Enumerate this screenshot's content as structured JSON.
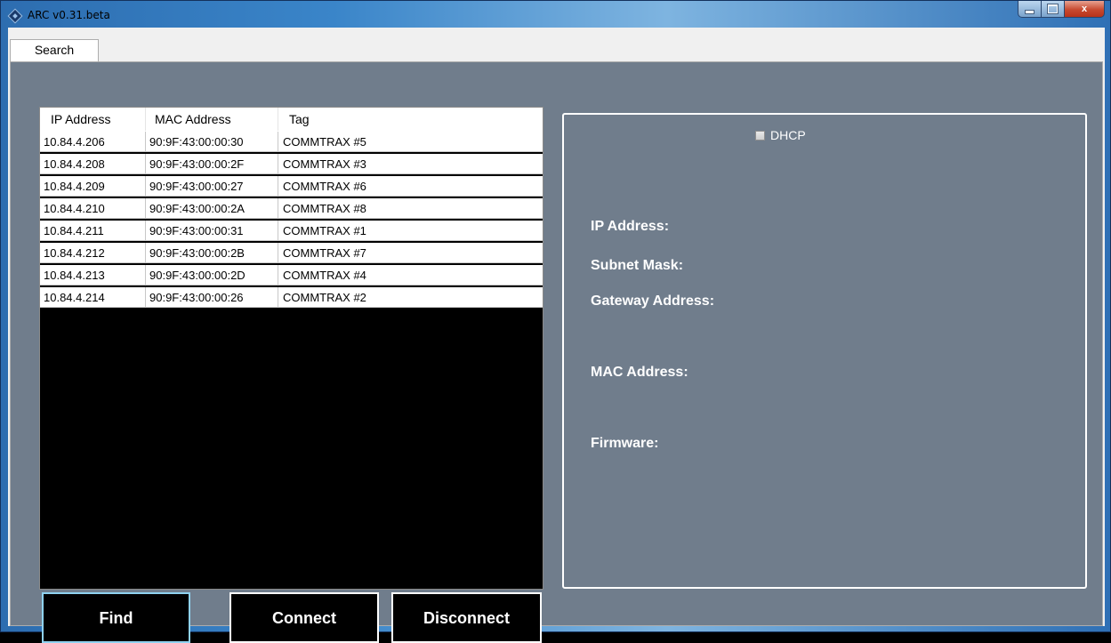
{
  "window": {
    "title": "ARC v0.31.beta",
    "close_glyph": "x"
  },
  "tabs": [
    {
      "label": "Search"
    }
  ],
  "list": {
    "columns": [
      "IP Address",
      "MAC Address",
      "Tag"
    ],
    "rows": [
      [
        "10.84.4.206",
        "90:9F:43:00:00:30",
        "COMMTRAX #5"
      ],
      [
        "10.84.4.208",
        "90:9F:43:00:00:2F",
        "COMMTRAX #3"
      ],
      [
        "10.84.4.209",
        "90:9F:43:00:00:27",
        "COMMTRAX #6"
      ],
      [
        "10.84.4.210",
        "90:9F:43:00:00:2A",
        "COMMTRAX #8"
      ],
      [
        "10.84.4.211",
        "90:9F:43:00:00:31",
        "COMMTRAX #1"
      ],
      [
        "10.84.4.212",
        "90:9F:43:00:00:2B",
        "COMMTRAX #7"
      ],
      [
        "10.84.4.213",
        "90:9F:43:00:00:2D",
        "COMMTRAX #4"
      ],
      [
        "10.84.4.214",
        "90:9F:43:00:00:26",
        "COMMTRAX #2"
      ]
    ]
  },
  "buttons": {
    "find": "Find",
    "connect": "Connect",
    "disconnect": "Disconnect"
  },
  "details": {
    "dhcp_label": "DHCP",
    "dhcp_checked": false,
    "ip_label": "IP Address:",
    "subnet_label": "Subnet Mask:",
    "gateway_label": "Gateway Address:",
    "mac_label": "MAC Address:",
    "firmware_label": "Firmware:"
  },
  "colors": {
    "panel_bg": "#707d8c",
    "list_bg": "#000000",
    "button_bg": "#000000",
    "focus_border": "#8fd2f0"
  }
}
